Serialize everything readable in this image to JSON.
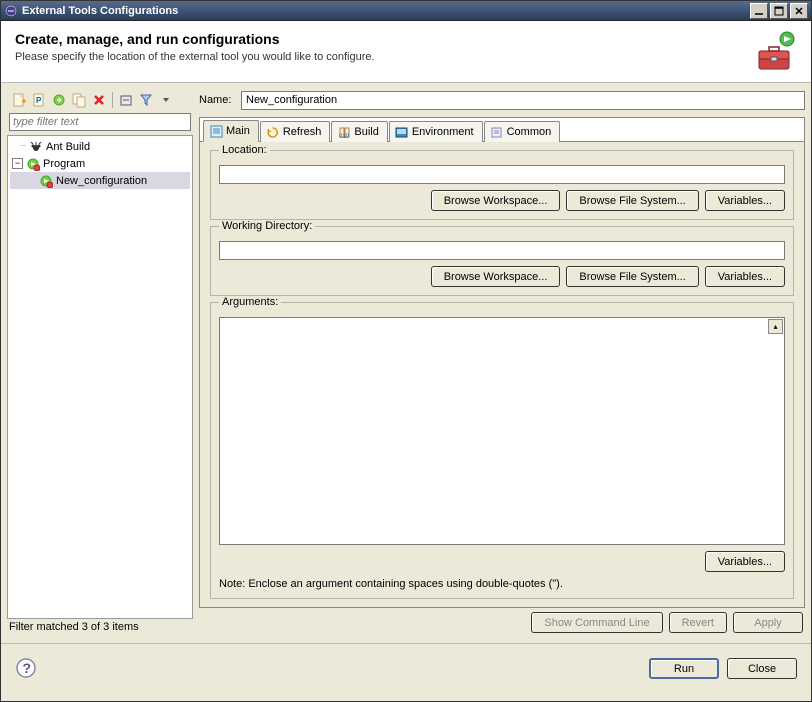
{
  "title": "External Tools Configurations",
  "header": {
    "title": "Create, manage, and run configurations",
    "subtitle": "Please specify the location of the external tool you would like to configure."
  },
  "filter": {
    "placeholder": "type filter text"
  },
  "tree": {
    "ant": "Ant Build",
    "program": "Program",
    "newconfig": "New_configuration"
  },
  "filterStatus": "Filter matched 3 of 3 items",
  "name": {
    "label": "Name:",
    "value": "New_configuration"
  },
  "tabs": {
    "main": "Main",
    "refresh": "Refresh",
    "build": "Build",
    "environment": "Environment",
    "common": "Common"
  },
  "groups": {
    "location": "Location:",
    "workdir": "Working Directory:",
    "arguments": "Arguments:"
  },
  "buttons": {
    "browseWorkspace": "Browse Workspace...",
    "browseFileSystem": "Browse File System...",
    "variables": "Variables...",
    "showCmd": "Show Command Line",
    "revert": "Revert",
    "apply": "Apply",
    "run": "Run",
    "close": "Close"
  },
  "note": "Note: Enclose an argument containing spaces using double-quotes (\")."
}
